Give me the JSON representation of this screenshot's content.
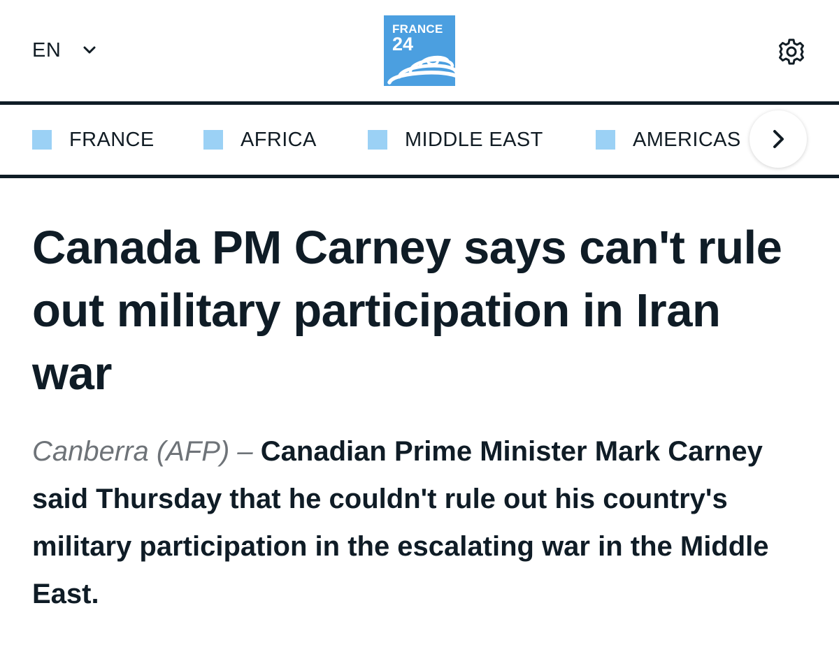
{
  "header": {
    "language": "EN",
    "logo": {
      "line1": "FRANCE",
      "line2": "24",
      "color": "#4b9fe0"
    },
    "language_chevron_icon": "chevron-down-icon",
    "settings_icon": "gear-icon"
  },
  "nav": {
    "accent_color": "#9bd1f5",
    "items": [
      {
        "label": "FRANCE"
      },
      {
        "label": "AFRICA"
      },
      {
        "label": "MIDDLE EAST"
      },
      {
        "label": "AMERICAS"
      }
    ],
    "next_icon": "chevron-right-icon"
  },
  "article": {
    "headline": "Canada PM Carney says can't rule out military participation in Iran war",
    "dateline": "Canberra (AFP) –",
    "lead": "Canadian Prime Minister Mark Carney said Thursday that he couldn't rule out his country's military participation in the escalating war in the Middle East."
  }
}
